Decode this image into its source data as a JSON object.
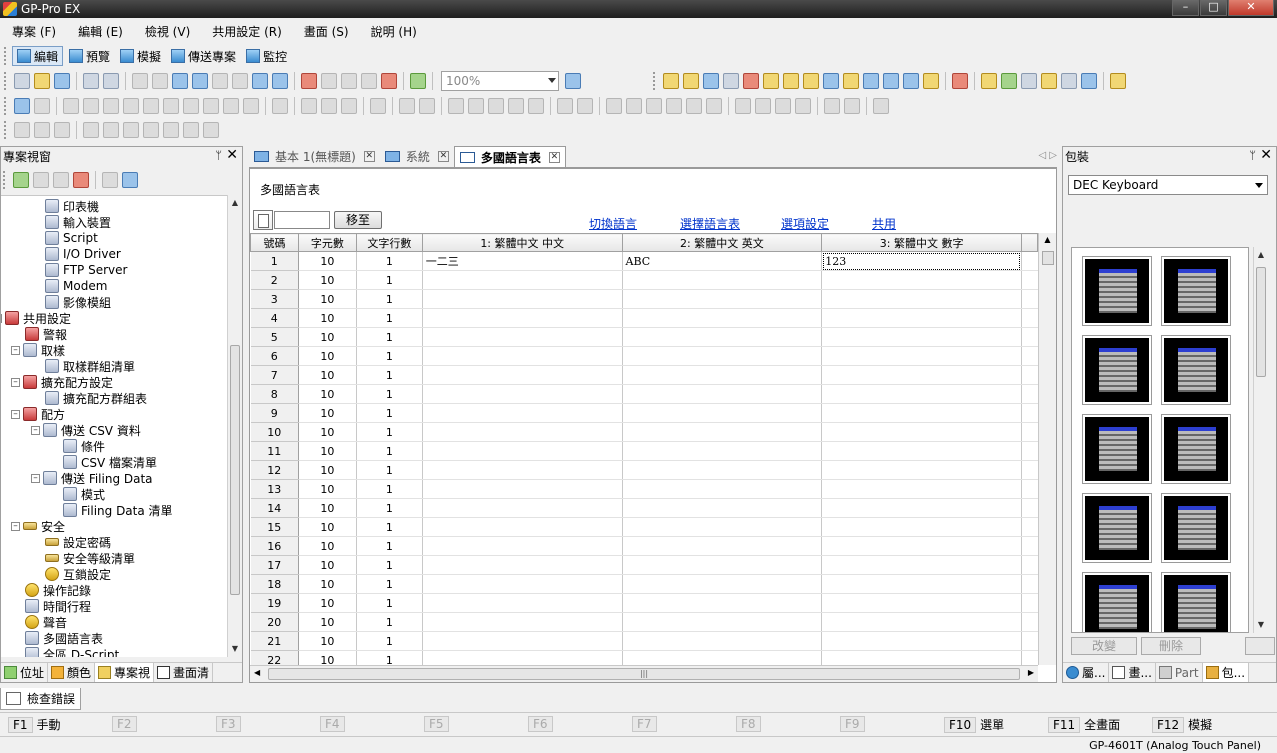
{
  "app": {
    "title": "GP-Pro EX"
  },
  "window_buttons": {
    "minimize": "–",
    "maximize": "□",
    "close": "✕"
  },
  "menu": [
    "專案 (F)",
    "編輯 (E)",
    "檢視 (V)",
    "共用設定 (R)",
    "畫面 (S)",
    "說明 (H)"
  ],
  "modes": [
    "編輯",
    "預覽",
    "模擬",
    "傳送專案",
    "監控"
  ],
  "toolbar": {
    "zoom_value": "100%"
  },
  "project_panel": {
    "title": "專案視窗",
    "pin": "ᛘ",
    "close": "✕",
    "tree": [
      {
        "label": "印表機",
        "level": 3,
        "icon": "printer-icon"
      },
      {
        "label": "輸入裝置",
        "level": 3,
        "icon": "input-device-icon"
      },
      {
        "label": "Script",
        "level": 3,
        "icon": "script-icon"
      },
      {
        "label": "I/O Driver",
        "level": 3,
        "icon": "io-driver-icon"
      },
      {
        "label": "FTP Server",
        "level": 3,
        "icon": "ftp-server-icon"
      },
      {
        "label": "Modem",
        "level": 3,
        "icon": "modem-icon"
      },
      {
        "label": "影像模組",
        "level": 3,
        "icon": "video-module-icon"
      },
      {
        "label": "共用設定",
        "level": 1,
        "icon": "common-settings-icon",
        "exp": "–"
      },
      {
        "label": "警報",
        "level": 2,
        "icon": "alarm-icon"
      },
      {
        "label": "取樣",
        "level": 2,
        "icon": "sampling-icon",
        "exp": "–"
      },
      {
        "label": "取樣群組清單",
        "level": 3,
        "icon": "sampling-group-icon"
      },
      {
        "label": "擴充配方設定",
        "level": 2,
        "icon": "extended-recipe-icon",
        "exp": "–"
      },
      {
        "label": "擴充配方群組表",
        "level": 3,
        "icon": "recipe-group-icon"
      },
      {
        "label": "配方",
        "level": 2,
        "icon": "recipe-icon",
        "exp": "–"
      },
      {
        "label": "傳送 CSV 資料",
        "level": 3,
        "icon": "csv-transfer-icon",
        "exp": "–"
      },
      {
        "label": "條件",
        "level": 4,
        "icon": "condition-icon"
      },
      {
        "label": "CSV 檔案清單",
        "level": 4,
        "icon": "csv-file-list-icon"
      },
      {
        "label": "傳送 Filing Data",
        "level": 3,
        "icon": "filing-data-icon",
        "exp": "–"
      },
      {
        "label": "模式",
        "level": 4,
        "icon": "mode-icon"
      },
      {
        "label": "Filing Data 清單",
        "level": 4,
        "icon": "filing-list-icon"
      },
      {
        "label": "安全",
        "level": 2,
        "icon": "security-key-icon",
        "exp": "–"
      },
      {
        "label": "設定密碼",
        "level": 3,
        "icon": "password-key-icon"
      },
      {
        "label": "安全等級清單",
        "level": 3,
        "icon": "security-level-icon"
      },
      {
        "label": "互鎖設定",
        "level": 3,
        "icon": "interlock-icon"
      },
      {
        "label": "操作記錄",
        "level": 2,
        "icon": "operation-log-icon"
      },
      {
        "label": "時間行程",
        "level": 2,
        "icon": "time-schedule-icon"
      },
      {
        "label": "聲音",
        "level": 2,
        "icon": "sound-icon"
      },
      {
        "label": "多國語言表",
        "level": 2,
        "icon": "language-table-icon"
      },
      {
        "label": "全區 D-Script",
        "level": 2,
        "icon": "dscript-icon"
      }
    ],
    "tabs": [
      "位址",
      "顏色",
      "專案視",
      "畫面清"
    ]
  },
  "doc_tabs": [
    {
      "label": "基本 1(無標題)",
      "active": false
    },
    {
      "label": "系統",
      "active": false
    },
    {
      "label": "多國語言表",
      "active": true
    }
  ],
  "doc_nav": "◁ ▷",
  "doc": {
    "heading": "多國語言表",
    "goto_label": "移至",
    "links": [
      "切換語言",
      "選擇語言表",
      "選項設定",
      "共用"
    ],
    "columns": [
      "號碼",
      "字元數",
      "文字行數",
      "1: 繁體中文 中文",
      "2: 繁體中文 英文",
      "3: 繁體中文 數字"
    ],
    "rows": [
      [
        "1",
        "10",
        "1",
        "一二三",
        "ABC",
        "123"
      ],
      [
        "2",
        "10",
        "1",
        "",
        "",
        ""
      ],
      [
        "3",
        "10",
        "1",
        "",
        "",
        ""
      ],
      [
        "4",
        "10",
        "1",
        "",
        "",
        ""
      ],
      [
        "5",
        "10",
        "1",
        "",
        "",
        ""
      ],
      [
        "6",
        "10",
        "1",
        "",
        "",
        ""
      ],
      [
        "7",
        "10",
        "1",
        "",
        "",
        ""
      ],
      [
        "8",
        "10",
        "1",
        "",
        "",
        ""
      ],
      [
        "9",
        "10",
        "1",
        "",
        "",
        ""
      ],
      [
        "10",
        "10",
        "1",
        "",
        "",
        ""
      ],
      [
        "11",
        "10",
        "1",
        "",
        "",
        ""
      ],
      [
        "12",
        "10",
        "1",
        "",
        "",
        ""
      ],
      [
        "13",
        "10",
        "1",
        "",
        "",
        ""
      ],
      [
        "14",
        "10",
        "1",
        "",
        "",
        ""
      ],
      [
        "15",
        "10",
        "1",
        "",
        "",
        ""
      ],
      [
        "16",
        "10",
        "1",
        "",
        "",
        ""
      ],
      [
        "17",
        "10",
        "1",
        "",
        "",
        ""
      ],
      [
        "18",
        "10",
        "1",
        "",
        "",
        ""
      ],
      [
        "19",
        "10",
        "1",
        "",
        "",
        ""
      ],
      [
        "20",
        "10",
        "1",
        "",
        "",
        ""
      ],
      [
        "21",
        "10",
        "1",
        "",
        "",
        ""
      ],
      [
        "22",
        "10",
        "1",
        "",
        "",
        ""
      ]
    ]
  },
  "package_panel": {
    "title": "包裝",
    "pin": "ᛘ",
    "close": "✕",
    "selected": "DEC Keyboard",
    "buttons": [
      "改變",
      "刪除"
    ],
    "tabs": [
      "屬...",
      "畫...",
      "Part",
      "包..."
    ]
  },
  "bottom": {
    "error_tab": "檢查錯誤",
    "fkeys": [
      {
        "key": "F1",
        "label": "手動",
        "enabled": true
      },
      {
        "key": "F2",
        "label": "",
        "enabled": false
      },
      {
        "key": "F3",
        "label": "",
        "enabled": false
      },
      {
        "key": "F4",
        "label": "",
        "enabled": false
      },
      {
        "key": "F5",
        "label": "",
        "enabled": false
      },
      {
        "key": "F6",
        "label": "",
        "enabled": false
      },
      {
        "key": "F7",
        "label": "",
        "enabled": false
      },
      {
        "key": "F8",
        "label": "",
        "enabled": false
      },
      {
        "key": "F9",
        "label": "",
        "enabled": false
      },
      {
        "key": "F10",
        "label": "選單",
        "enabled": true
      },
      {
        "key": "F11",
        "label": "全畫面",
        "enabled": true
      },
      {
        "key": "F12",
        "label": "模擬",
        "enabled": true
      }
    ],
    "status": "GP-4601T (Analog Touch Panel)"
  }
}
